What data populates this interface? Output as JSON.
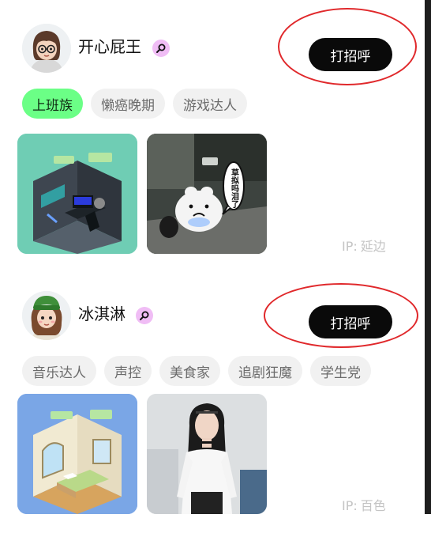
{
  "users": [
    {
      "name": "开心屁王",
      "greet_label": "打招呼",
      "tags": [
        "上班族",
        "懒癌晚期",
        "游戏达人"
      ],
      "active_tag": 0,
      "ip_label": "IP:",
      "ip_location": "延边",
      "sticker_text": "草拟吗泪了"
    },
    {
      "name": "冰淇淋",
      "greet_label": "打招呼",
      "tags": [
        "音乐达人",
        "声控",
        "美食家",
        "追剧狂魔",
        "学生党"
      ],
      "active_tag": -1,
      "ip_label": "IP:",
      "ip_location": "百色"
    }
  ],
  "colors": {
    "button_bg": "#0a0a0a",
    "active_tag_bg": "#6bff86",
    "tag_bg": "#f1f1f1",
    "badge_bg": "#f0bdf5",
    "annotation_circle": "#e0282b"
  },
  "icons": {
    "badge": "search-icon"
  }
}
